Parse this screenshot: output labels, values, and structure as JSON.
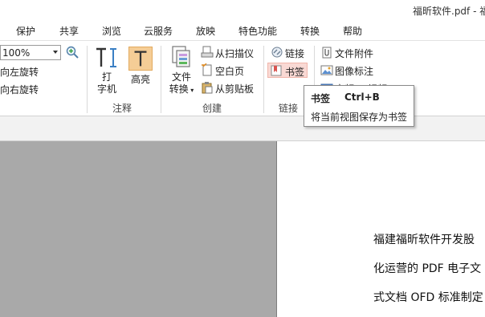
{
  "window": {
    "title": "福昕软件.pdf - 福"
  },
  "tabs": [
    "保护",
    "共享",
    "浏览",
    "云服务",
    "放映",
    "特色功能",
    "转换",
    "帮助"
  ],
  "ribbon": {
    "zoom": {
      "value": "100%"
    },
    "rotate_left": "向左旋转",
    "rotate_right": "向右旋转",
    "typewriter": {
      "line1": "打",
      "line2": "字机"
    },
    "highlight": "高亮",
    "annotate_group": "注释",
    "convert_file": {
      "line1": "文件",
      "line2": "转换"
    },
    "from_scanner": "从扫描仪",
    "blank_page": "空白页",
    "from_clipboard": "从剪贴板",
    "create_group": "创建",
    "link": "链接",
    "bookmark": "书签",
    "link_group": "链接",
    "file_attachment": "文件附件",
    "image_annotation": "图像标注",
    "audio_video": "音频 & 视频"
  },
  "tooltip": {
    "title": "书签",
    "shortcut": "Ctrl+B",
    "description": "将当前视图保存为书签"
  },
  "document": {
    "lines": [
      "福建福昕软件开发股",
      "化运营的 PDF 电子文",
      "式文档 OFD 标准制定"
    ]
  },
  "colors": {
    "highlight_bg": "#f5cd96",
    "bookmark_bg": "#f9d9d4",
    "workspace_bg": "#a9a9a9"
  }
}
